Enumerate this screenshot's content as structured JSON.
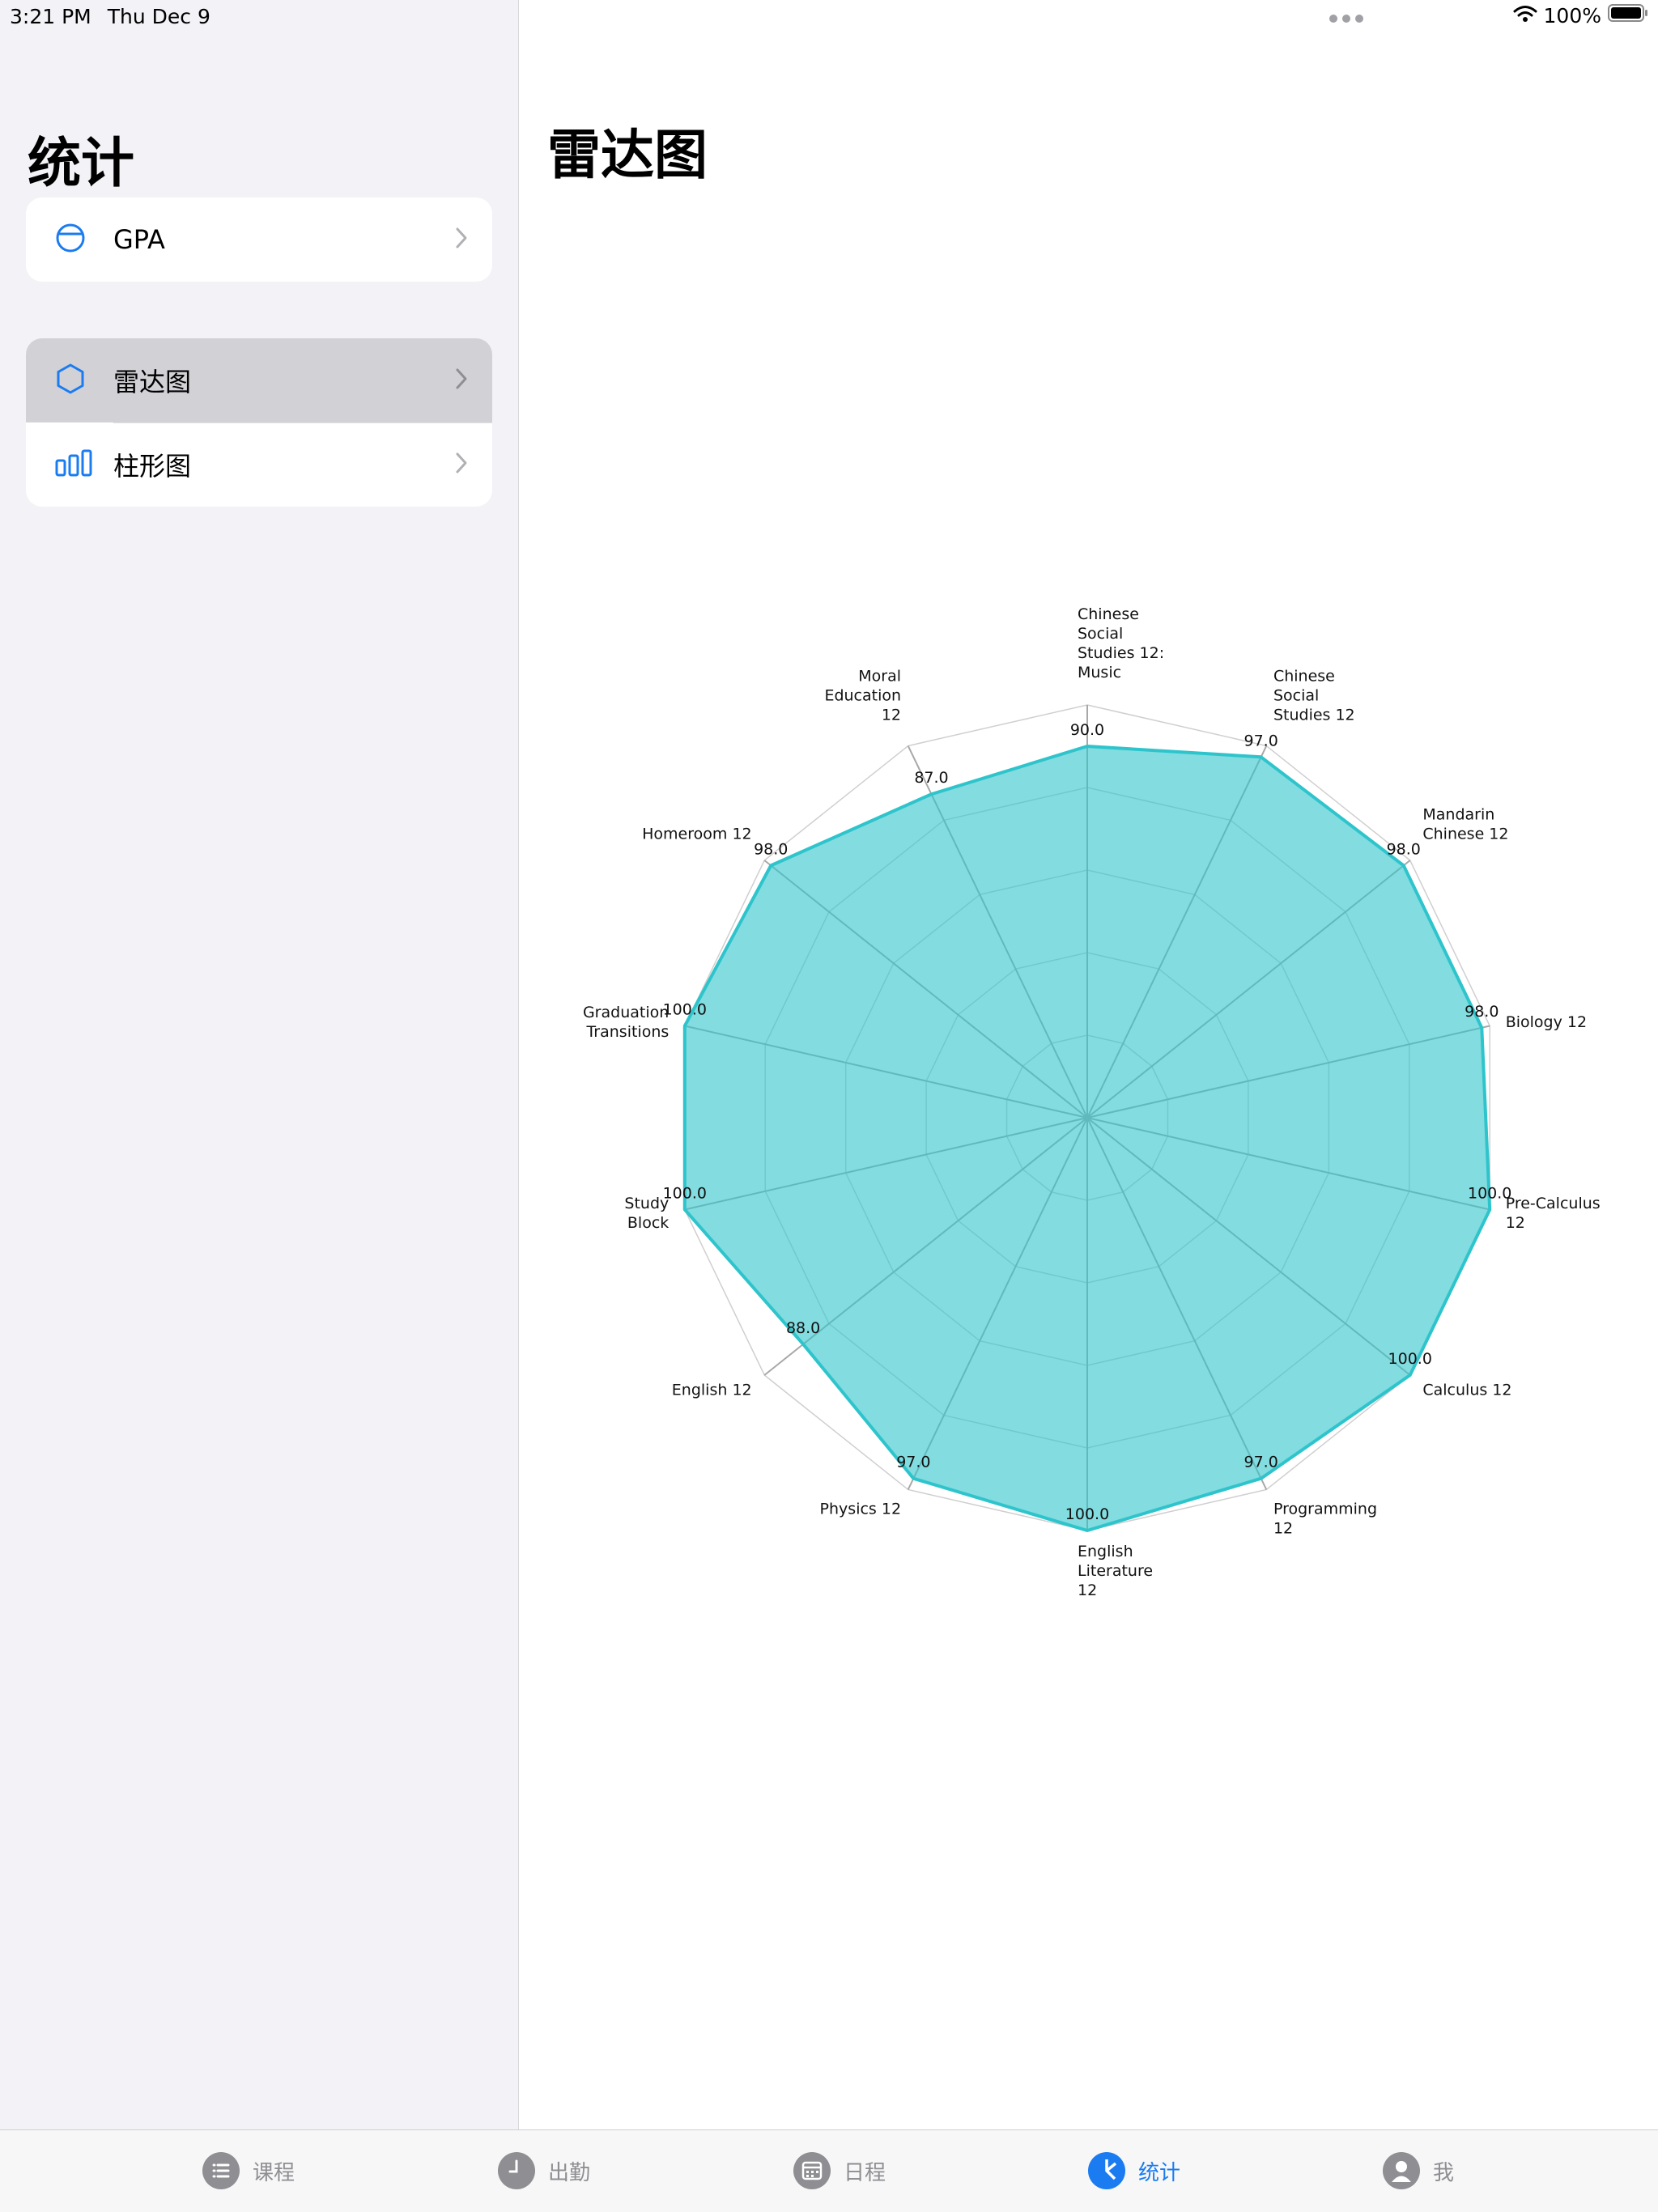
{
  "status_bar": {
    "time": "3:21 PM",
    "date": "Thu Dec 9",
    "battery": "100%"
  },
  "sidebar": {
    "title": "统计",
    "groups": [
      [
        {
          "label": "GPA",
          "icon": "circle-icon"
        }
      ],
      [
        {
          "label": "雷达图",
          "icon": "hexagon-icon",
          "selected": true
        },
        {
          "label": "柱形图",
          "icon": "bar-chart-icon"
        }
      ]
    ]
  },
  "main": {
    "title": "雷达图"
  },
  "chart_data": {
    "type": "radar",
    "range": [
      0,
      100
    ],
    "rings": 5,
    "color": "#2ec4cc",
    "axes": [
      "Chinese\nSocial\nStudies 12:\nMusic",
      "Chinese\nSocial\nStudies 12",
      "Mandarin\nChinese 12",
      "Biology 12",
      "Pre-Calculus\n12",
      "Calculus 12",
      "Programming\n12",
      "English\nLiterature\n12",
      "Physics 12",
      "English 12",
      "Study\nBlock",
      "Graduation\nTransitions",
      "Homeroom 12",
      "Moral\nEducation\n12"
    ],
    "values": [
      90.0,
      97.0,
      98.0,
      98.0,
      100.0,
      100.0,
      97.0,
      100.0,
      97.0,
      88.0,
      100.0,
      100.0,
      98.0,
      87.0
    ],
    "value_labels": [
      "90.0",
      "97.0",
      "98.0",
      "98.0",
      "100.0",
      "100.0",
      "97.0",
      "100.0",
      "97.0",
      "88.0",
      "100.0",
      "100.0",
      "98.0",
      "87.0"
    ]
  },
  "tabbar": {
    "items": [
      {
        "label": "课程",
        "icon": "list-icon"
      },
      {
        "label": "出勤",
        "icon": "clock-icon"
      },
      {
        "label": "日程",
        "icon": "calendar-icon"
      },
      {
        "label": "统计",
        "icon": "pie-chart-icon",
        "active": true
      },
      {
        "label": "我",
        "icon": "person-icon"
      }
    ]
  },
  "colors": {
    "accent": "#1a7cf0",
    "radar_fill": "#2ec4cc",
    "sidebar_bg": "#f2f2f7"
  }
}
